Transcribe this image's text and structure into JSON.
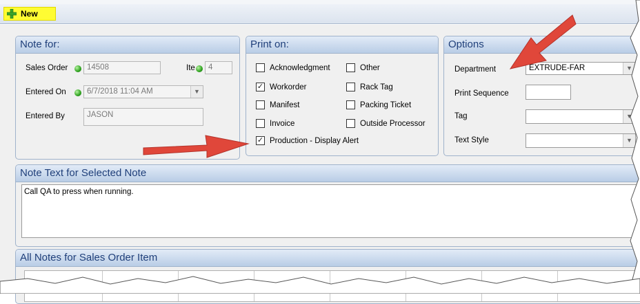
{
  "toolbar": {
    "new_label": "New",
    "new_icon": "plus-icon"
  },
  "note_for": {
    "title": "Note for:",
    "sales_order_label": "Sales Order",
    "sales_order_value": "14508",
    "item_label": "Ite",
    "item_value": "4",
    "entered_on_label": "Entered On",
    "entered_on_value": "6/7/2018 11:04 AM",
    "entered_by_label": "Entered By",
    "entered_by_value": "JASON"
  },
  "print_on": {
    "title": "Print on:",
    "items": [
      {
        "label": "Acknowledgment",
        "checked": false
      },
      {
        "label": "Other",
        "checked": false
      },
      {
        "label": "Workorder",
        "checked": true
      },
      {
        "label": "Rack Tag",
        "checked": false
      },
      {
        "label": "Manifest",
        "checked": false
      },
      {
        "label": "Packing Ticket",
        "checked": false
      },
      {
        "label": "Invoice",
        "checked": false
      },
      {
        "label": "Outside Processor",
        "checked": false
      },
      {
        "label": "Production - Display Alert",
        "checked": true
      }
    ]
  },
  "options": {
    "title": "Options",
    "department_label": "Department",
    "department_value": "EXTRUDE-FAR",
    "print_sequence_label": "Print Sequence",
    "print_sequence_value": "",
    "tag_label": "Tag",
    "tag_value": "",
    "text_style_label": "Text Style",
    "text_style_value": ""
  },
  "note_text": {
    "title": "Note Text for Selected Note",
    "value": "Call QA to press when running."
  },
  "all_notes": {
    "title": "All Notes for Sales Order Item"
  },
  "colors": {
    "toolbar_new_bg": "#fffc33",
    "panel_header_text": "#1f3f7a",
    "status_dot": "#2ea11e",
    "annotation_arrow": "#e0473a"
  }
}
